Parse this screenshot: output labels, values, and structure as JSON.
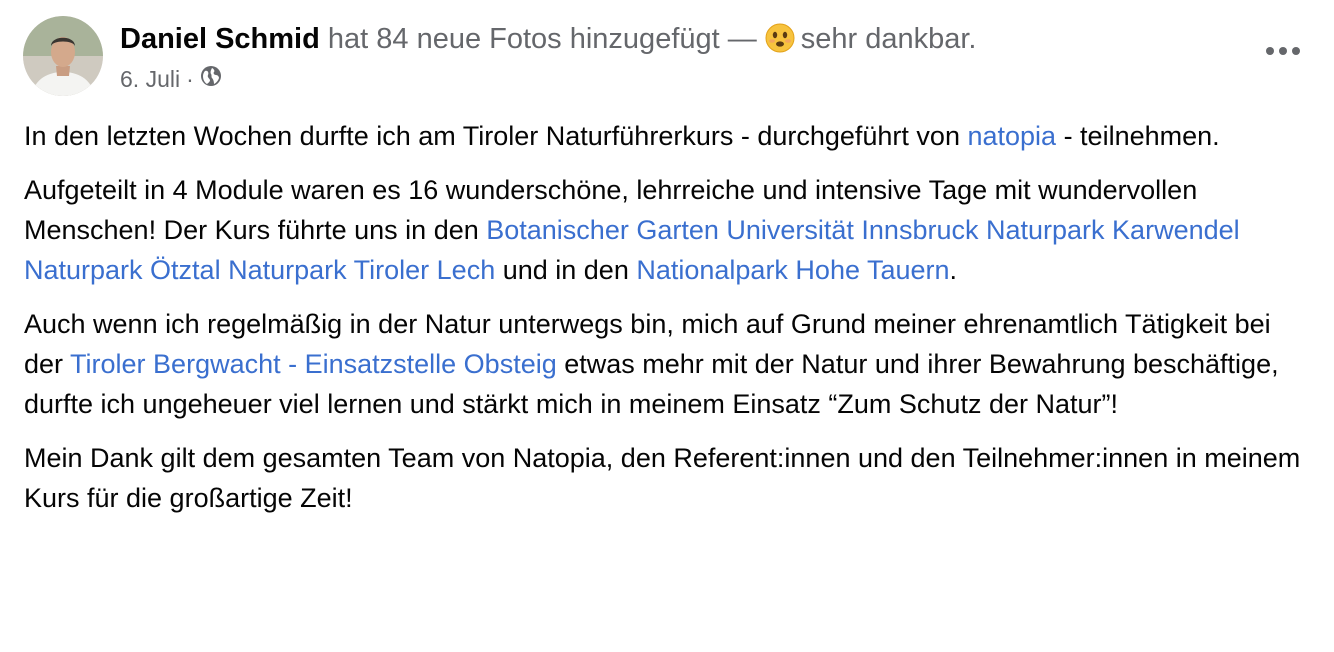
{
  "post": {
    "author": "Daniel Schmid",
    "action_text": "hat 84 neue Fotos hinzugefügt —",
    "feeling_emoji": "slightly-smiling-face-emoji",
    "feeling_text": "sehr dankbar.",
    "date": "6. Juli",
    "separator": "·",
    "privacy_icon": "globe-icon",
    "more_icon": "more-horizontal-icon"
  },
  "paragraphs": [
    {
      "segments": [
        {
          "text": "In den letzten Wochen durfte ich am Tiroler Naturführerkurs - durchgeführt von ",
          "link": false
        },
        {
          "text": "natopia",
          "link": true
        },
        {
          "text": " - teilnehmen.",
          "link": false
        }
      ]
    },
    {
      "segments": [
        {
          "text": "Aufgeteilt in 4 Module waren es 16 wunderschöne, lehrreiche und intensive Tage mit wundervollen Menschen! Der Kurs führte uns in den ",
          "link": false
        },
        {
          "text": "Botanischer Garten Universität Innsbruck",
          "link": true
        },
        {
          "text": " ",
          "link": false
        },
        {
          "text": "Naturpark Karwendel",
          "link": true
        },
        {
          "text": " ",
          "link": false
        },
        {
          "text": "Naturpark Ötztal",
          "link": true
        },
        {
          "text": " ",
          "link": false
        },
        {
          "text": "Naturpark Tiroler Lech",
          "link": true
        },
        {
          "text": " und in den ",
          "link": false
        },
        {
          "text": "Nationalpark Hohe Tauern",
          "link": true
        },
        {
          "text": ".",
          "link": false
        }
      ]
    },
    {
      "segments": [
        {
          "text": "Auch wenn ich regelmäßig in der Natur unterwegs bin, mich auf Grund meiner ehrenamtlich Tätigkeit bei der ",
          "link": false
        },
        {
          "text": "Tiroler Bergwacht - Einsatzstelle Obsteig",
          "link": true
        },
        {
          "text": " etwas mehr mit der Natur und ihrer Bewahrung beschäftige, durfte ich ungeheuer viel lernen und stärkt mich in meinem Einsatz “Zum Schutz der Natur”!",
          "link": false
        }
      ]
    },
    {
      "segments": [
        {
          "text": "Mein Dank gilt dem gesamten Team von Natopia, den Referent:innen und den Teilnehmer:innen in meinem Kurs für die großartige Zeit!",
          "link": false
        }
      ]
    }
  ],
  "colors": {
    "link": "#3a6fcf",
    "secondary_text": "#65676b",
    "primary_text": "#050505"
  }
}
